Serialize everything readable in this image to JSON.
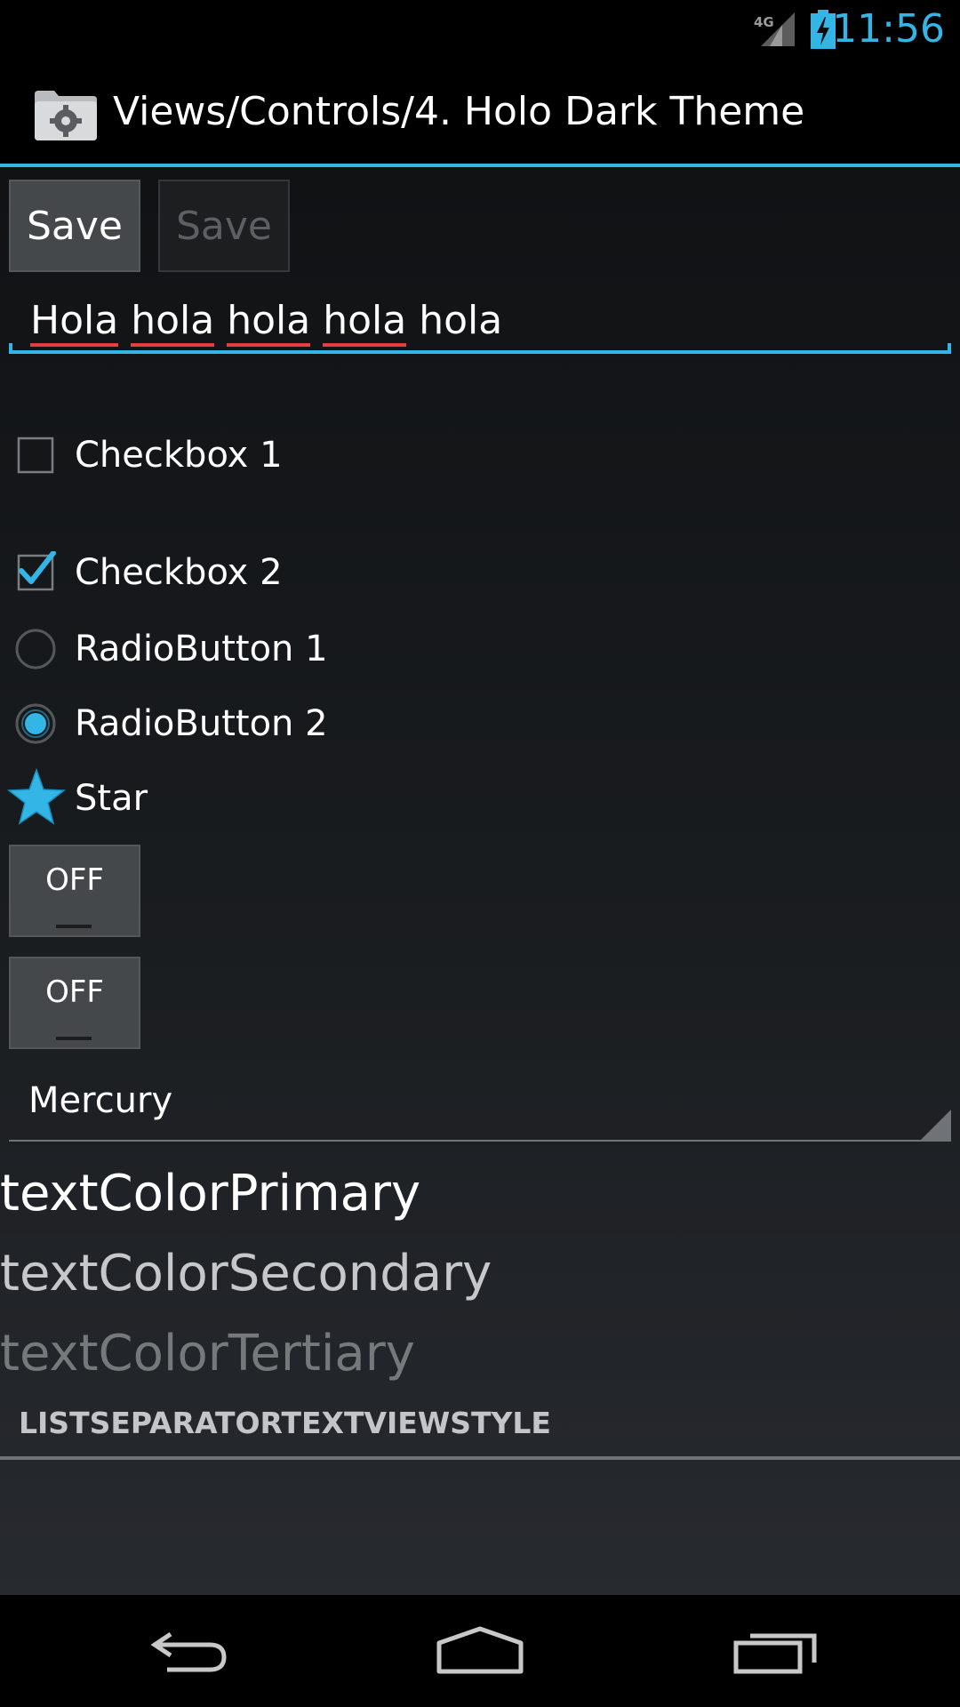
{
  "status_bar": {
    "clock": "11:56",
    "network_type": "4G",
    "signal_icon": "signal-icon",
    "battery_icon": "battery-charging-icon",
    "accent_color": "#33b5e5"
  },
  "action_bar": {
    "app_icon": "settings-folder-icon",
    "title": "Views/Controls/4. Holo Dark Theme"
  },
  "buttons": {
    "save_label": "Save",
    "save_disabled_label": "Save"
  },
  "edit_text": {
    "words": [
      "Hola",
      "hola",
      "hola",
      "hola",
      "hola"
    ]
  },
  "checkboxes": [
    {
      "label": "Checkbox 1",
      "checked": false
    },
    {
      "label": "Checkbox 2",
      "checked": true
    }
  ],
  "radio_buttons": [
    {
      "label": "RadioButton 1",
      "checked": false
    },
    {
      "label": "RadioButton 2",
      "checked": true
    }
  ],
  "star": {
    "label": "Star",
    "checked": true
  },
  "toggles": [
    {
      "label": "OFF"
    },
    {
      "label": "OFF"
    }
  ],
  "spinner": {
    "selected": "Mercury"
  },
  "text_colors": {
    "primary": "textColorPrimary",
    "secondary": "textColorSecondary",
    "tertiary": "textColorTertiary"
  },
  "list_separator": {
    "label": "LISTSEPARATORTEXTVIEWSTYLE"
  },
  "nav_bar": {
    "back_icon": "back-icon",
    "home_icon": "home-icon",
    "recents_icon": "recent-apps-icon"
  }
}
